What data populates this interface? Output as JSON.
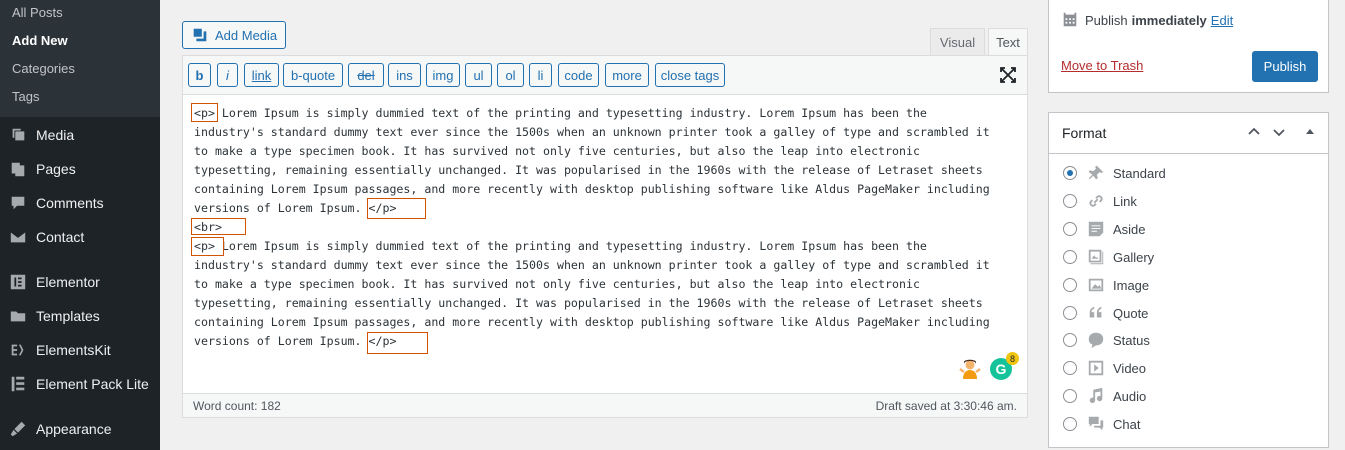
{
  "sidebar": {
    "submenu": [
      {
        "label": "All Posts",
        "current": false
      },
      {
        "label": "Add New",
        "current": true
      },
      {
        "label": "Categories",
        "current": false
      },
      {
        "label": "Tags",
        "current": false
      }
    ],
    "menu": [
      {
        "label": "Media",
        "icon": "media-icon"
      },
      {
        "label": "Pages",
        "icon": "pages-icon"
      },
      {
        "label": "Comments",
        "icon": "comments-icon"
      },
      {
        "label": "Contact",
        "icon": "contact-icon"
      },
      {
        "label": "Elementor",
        "icon": "elementor-icon"
      },
      {
        "label": "Templates",
        "icon": "templates-icon"
      },
      {
        "label": "ElementsKit",
        "icon": "elementskit-icon"
      },
      {
        "label": "Element Pack Lite",
        "icon": "element-pack-icon"
      },
      {
        "label": "Appearance",
        "icon": "appearance-icon"
      }
    ]
  },
  "editor": {
    "add_media": "Add Media",
    "tab_visual": "Visual",
    "tab_text": "Text",
    "quicktags": [
      "b",
      "i",
      "link",
      "b-quote",
      "del",
      "ins",
      "img",
      "ul",
      "ol",
      "li",
      "code",
      "more",
      "close tags"
    ],
    "lines": [
      "<p> Lorem Ipsum is simply dummied text of the printing and typesetting industry. Lorem Ipsum has been the",
      "industry's standard dummy text ever since the 1500s when an unknown printer took a galley of type and scrambled it",
      "to make a type specimen book. It has survived not only five centuries, but also the leap into electronic",
      "typesetting, remaining essentially unchanged. It was popularised in the 1960s with the release of Letraset sheets",
      "containing Lorem Ipsum passages, and more recently with desktop publishing software like Aldus PageMaker including",
      "versions of Lorem Ipsum. </p>",
      "<br>",
      "<p> Lorem Ipsum is simply dummied text of the printing and typesetting industry. Lorem Ipsum has been the",
      "industry's standard dummy text ever since the 1500s when an unknown printer took a galley of type and scrambled it",
      "to make a type specimen book. It has survived not only five centuries, but also the leap into electronic",
      "typesetting, remaining essentially unchanged. It was popularised in the 1960s with the release of Letraset sheets",
      "containing Lorem Ipsum passages, and more recently with desktop publishing software like Aldus PageMaker including",
      "versions of Lorem Ipsum. </p>"
    ],
    "word_count": "Word count: 182",
    "draft_saved": "Draft saved at 3:30:46 am.",
    "grammarly_count": "8",
    "grammarly_letter": "G"
  },
  "publish": {
    "label": "Publish",
    "when": "immediately",
    "edit": "Edit",
    "trash": "Move to Trash",
    "button": "Publish"
  },
  "format": {
    "title": "Format",
    "options": [
      {
        "label": "Standard",
        "icon": "pin-icon",
        "checked": true
      },
      {
        "label": "Link",
        "icon": "link-icon",
        "checked": false
      },
      {
        "label": "Aside",
        "icon": "aside-icon",
        "checked": false
      },
      {
        "label": "Gallery",
        "icon": "gallery-icon",
        "checked": false
      },
      {
        "label": "Image",
        "icon": "image-icon",
        "checked": false
      },
      {
        "label": "Quote",
        "icon": "quote-icon",
        "checked": false
      },
      {
        "label": "Status",
        "icon": "status-icon",
        "checked": false
      },
      {
        "label": "Video",
        "icon": "video-icon",
        "checked": false
      },
      {
        "label": "Audio",
        "icon": "audio-icon",
        "checked": false
      },
      {
        "label": "Chat",
        "icon": "chat-icon",
        "checked": false
      }
    ]
  },
  "colors": {
    "accent": "#2271b1",
    "sidebar_bg": "#1d2327",
    "highlight_box": "#d35400",
    "trash": "#b32d2e"
  }
}
